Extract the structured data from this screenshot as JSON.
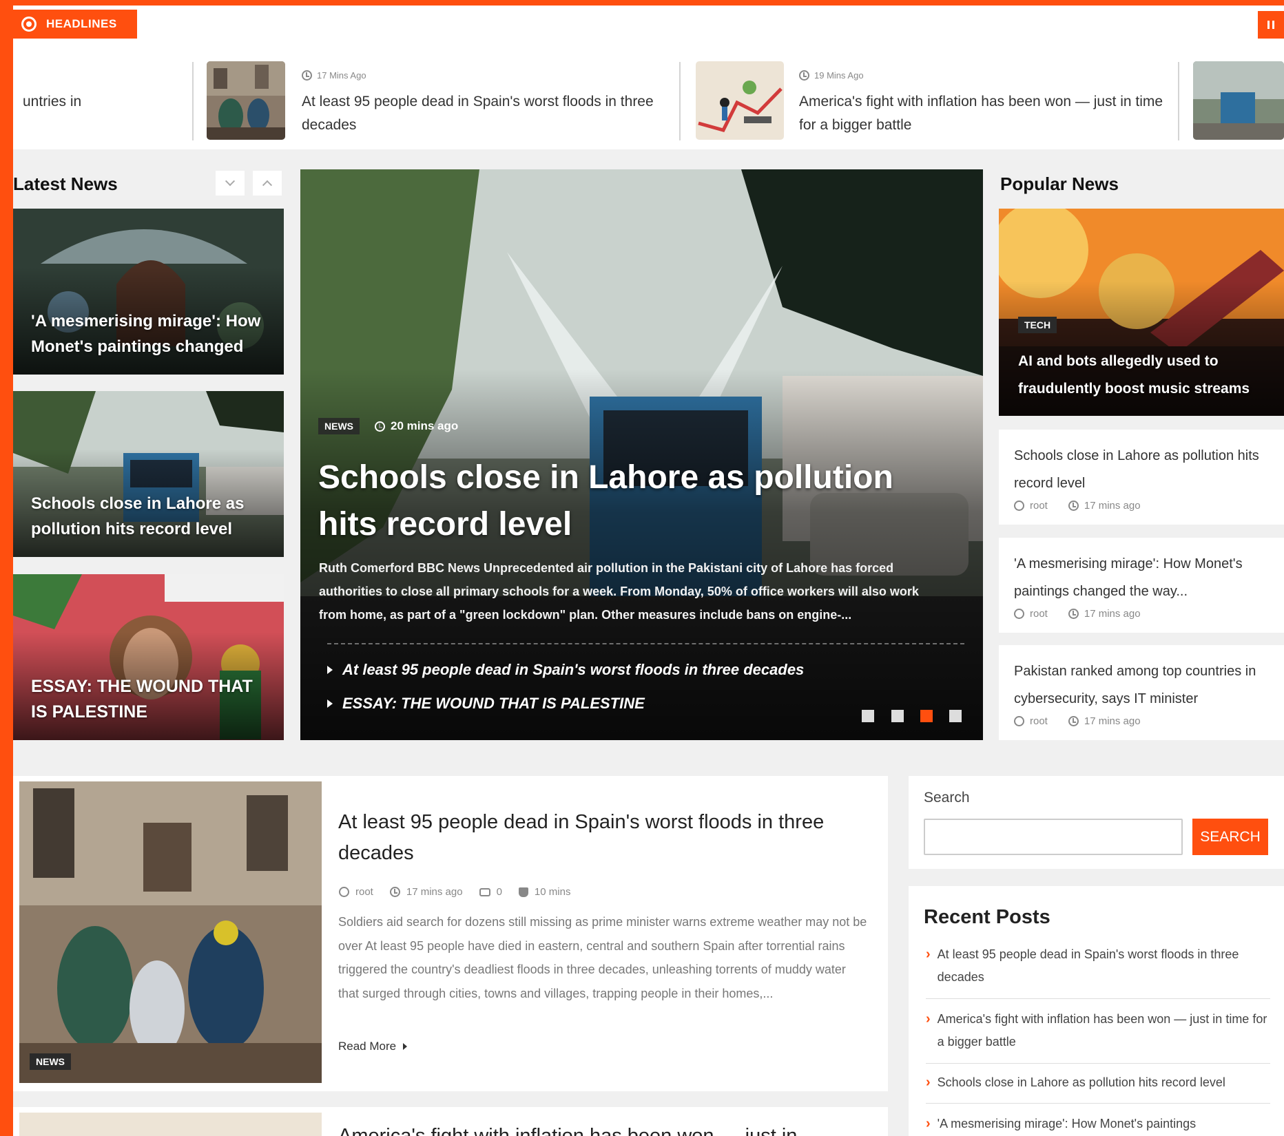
{
  "colors": {
    "accent": "#ff4f0f",
    "dark_tag": "#2a2a2a"
  },
  "ticker": {
    "badge": "HEADLINES",
    "items": [
      {
        "time": "",
        "text": "untries in"
      },
      {
        "time": "17 Mins Ago",
        "text": "At least 95 people dead in Spain's worst floods in three decades"
      },
      {
        "time": "19 Mins Ago",
        "text": "America's fight with inflation has been won — just in time for a bigger battle"
      }
    ],
    "icons": {
      "badge": "record-icon",
      "pause": "pause-icon",
      "time": "clock-icon"
    }
  },
  "latest": {
    "title": "Latest News",
    "controls": {
      "down": "chevron-down-icon",
      "up": "chevron-up-icon"
    },
    "items": [
      {
        "title": "'A mesmerising mirage': How Monet's paintings changed"
      },
      {
        "title": "Schools close in Lahore as pollution hits record level"
      },
      {
        "title": "ESSAY: THE WOUND THAT IS PALESTINE"
      }
    ]
  },
  "hero": {
    "tag": "NEWS",
    "time": "20 mins ago",
    "title": "Schools close in Lahore as pollution hits record level",
    "excerpt": "Ruth Comerford BBC News Unprecedented air pollution in the Pakistani city of Lahore has forced authorities to close all primary schools for a week. From Monday, 50% of office workers will also work from home, as part of a \"green lockdown\" plan. Other measures include bans on engine-...",
    "links": [
      "At least 95 people dead in Spain's worst floods in three decades",
      "ESSAY: THE WOUND THAT IS PALESTINE"
    ],
    "slides": {
      "count": 4,
      "active": 3
    }
  },
  "popular": {
    "title": "Popular News",
    "featured": {
      "tag": "TECH",
      "title": "AI and bots allegedly used to fraudulently boost music streams"
    },
    "items": [
      {
        "title": "Schools close in Lahore as pollution hits record level",
        "author": "root",
        "time": "17 mins ago"
      },
      {
        "title": "'A mesmerising mirage': How Monet's paintings changed the way...",
        "author": "root",
        "time": "17 mins ago"
      },
      {
        "title": "Pakistan ranked among top countries in cybersecurity, says IT minister",
        "author": "root",
        "time": "17 mins ago"
      }
    ]
  },
  "article": {
    "tag": "NEWS",
    "title": "At least 95 people dead in Spain's worst floods in three decades",
    "author": "root",
    "time": "17 mins ago",
    "comments": "0",
    "read_time": "10 mins",
    "excerpt": "Soldiers aid search for dozens still missing as prime minister warns extreme weather may not be over At least 95 people have died in eastern, central and southern Spain after torrential rains triggered the country's deadliest floods in three decades, unleashing torrents of muddy water that surged through cities, towns and villages, trapping people in their homes,...",
    "read_more": "Read More"
  },
  "article2": {
    "title": "America's fight with inflation has been won — just in"
  },
  "search": {
    "label": "Search",
    "placeholder": "",
    "button": "SEARCH"
  },
  "recent": {
    "title": "Recent Posts",
    "items": [
      "At least 95 people dead in Spain's worst floods in three decades",
      "America's fight with inflation has been won — just in time for a bigger battle",
      "Schools close in Lahore as pollution hits record level",
      "'A mesmerising mirage': How Monet's paintings"
    ]
  }
}
